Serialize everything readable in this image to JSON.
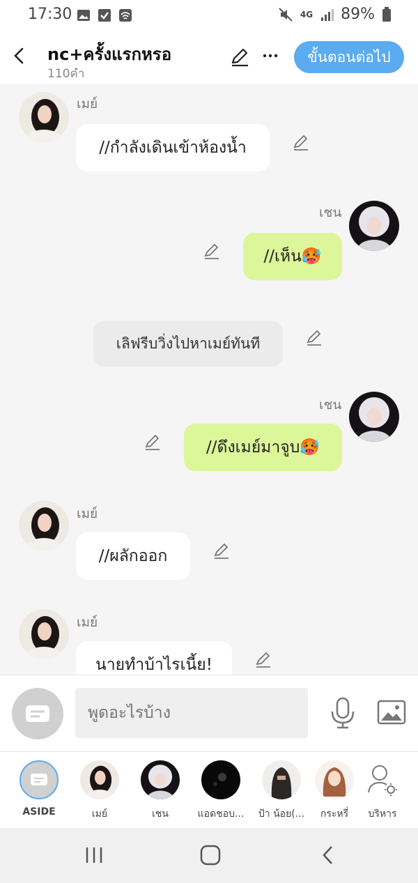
{
  "status": {
    "time": "17:30",
    "battery": "89%",
    "network": "4G"
  },
  "header": {
    "title": "nc+ครั้งแรกหรอ",
    "subtitle": "110คำ",
    "next_label": "ขั้นตอนต่อไป"
  },
  "messages": [
    {
      "speaker": "เมย์",
      "text": "//กำลังเดินเข้าห้องน้ำ",
      "side": "left"
    },
    {
      "speaker": "เชน",
      "text": "//เห็น🥵",
      "side": "right"
    },
    {
      "text": "เลิฟรีบวิ่งไปหาเมย์ทันที",
      "side": "narration"
    },
    {
      "speaker": "เชน",
      "text": "//ดึงเมย์มาจูบ🥵",
      "side": "right"
    },
    {
      "speaker": "เมย์",
      "text": "//ผลักออก",
      "side": "left"
    },
    {
      "speaker": "เมย์",
      "text": "นายทำบ้าไรเนี้ย!",
      "side": "left"
    }
  ],
  "composer": {
    "placeholder": "พูดอะไรบ้าง"
  },
  "characters": [
    {
      "label": "ASIDE"
    },
    {
      "label": "เมย์"
    },
    {
      "label": "เชน"
    },
    {
      "label": "แอดชอบ..."
    },
    {
      "label": "ป้า น้อย(..."
    },
    {
      "label": "กระหรี่"
    },
    {
      "label": "บริหาร"
    }
  ],
  "colors": {
    "accent": "#5aabef",
    "right_bubble": "#dcf69a",
    "left_bubble": "#ffffff",
    "narration_bubble": "#ebebeb"
  },
  "icons": [
    "back-icon",
    "edit-icon",
    "more-icon",
    "pencil-icon",
    "chat-icon",
    "mic-icon",
    "image-icon",
    "settings-user-icon",
    "recents-icon",
    "home-icon",
    "nav-back-icon"
  ]
}
